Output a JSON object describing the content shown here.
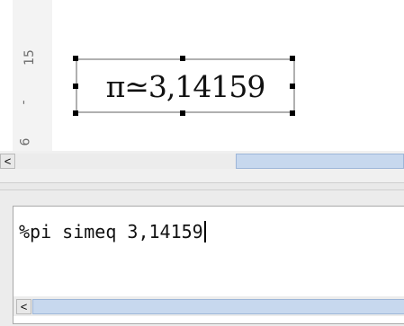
{
  "document": {
    "ruler": {
      "numbers": [
        "15",
        "-",
        "6"
      ]
    },
    "formula_render": "π≃3,14159"
  },
  "top_scrollbar": {
    "left_arrow_icon": "left-arrow-icon",
    "left_arrow_glyph": "<"
  },
  "command_editor": {
    "text": "%pi simeq 3,14159",
    "left_arrow_icon": "left-arrow-icon",
    "left_arrow_glyph": "<"
  },
  "colors": {
    "scroll_thumb": "#c7d8ee",
    "selection_frame": "#b0b0b0",
    "handle": "#000000"
  }
}
